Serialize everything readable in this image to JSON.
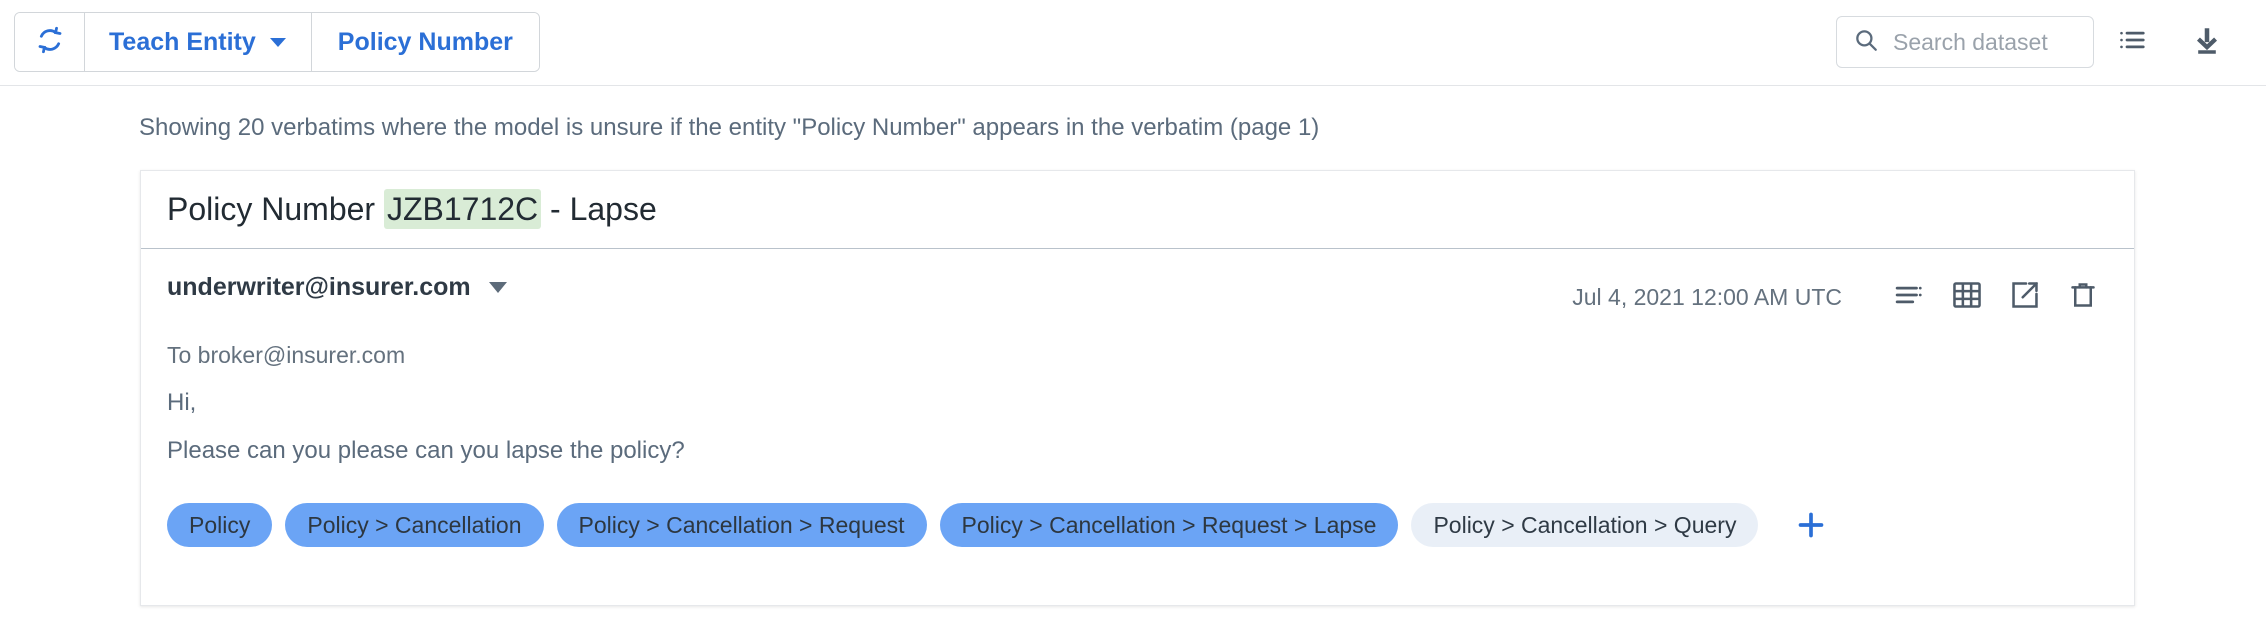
{
  "toolbar": {
    "refresh_icon": "refresh-icon",
    "teach_entity_label": "Teach Entity",
    "entity_label": "Policy Number",
    "search_placeholder": "Search dataset",
    "search_value": "",
    "search_icon": "search-icon",
    "list_view_icon": "list-icon",
    "download_icon": "download-icon"
  },
  "status": {
    "text": "Showing 20 verbatims where the model is unsure if the entity \"Policy Number\" appears in the verbatim (page 1)"
  },
  "card": {
    "title_prefix": "Policy Number ",
    "title_highlight": "JZB1712C",
    "title_suffix": " - Lapse",
    "highlight_color": "#d9ecd6",
    "message": {
      "sender": "underwriter@insurer.com",
      "recipient": "To broker@insurer.com",
      "timestamp": "Jul 4, 2021 12:00 AM UTC",
      "body_line_1": "Hi,",
      "body_line_2": "Please can you please can you lapse the policy?",
      "icons": {
        "metadata": "metadata-list-icon",
        "table": "table-grid-icon",
        "open": "external-link-icon",
        "delete": "trash-icon"
      }
    },
    "chips": [
      {
        "label": "Policy",
        "selected": true
      },
      {
        "label": "Policy > Cancellation",
        "selected": true
      },
      {
        "label": "Policy > Cancellation > Request",
        "selected": true
      },
      {
        "label": "Policy > Cancellation > Request > Lapse",
        "selected": true
      },
      {
        "label": "Policy > Cancellation > Query",
        "selected": false
      }
    ],
    "add_chip_icon": "plus-icon",
    "chip_selected_color": "#6ba4f5",
    "chip_unselected_color": "#e9eff7"
  },
  "colors": {
    "accent_blue": "#2b6fd6",
    "text_muted": "#5b6b7c"
  }
}
